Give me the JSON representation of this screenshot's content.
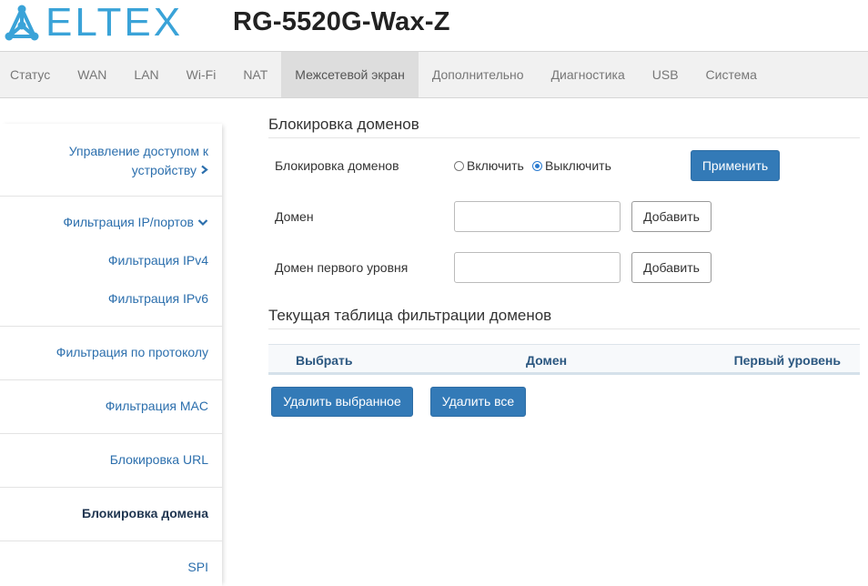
{
  "header": {
    "logo_text": "ELTEX",
    "device_title": "RG-5520G-Wax-Z"
  },
  "topnav": {
    "tabs": [
      {
        "label": "Статус"
      },
      {
        "label": "WAN"
      },
      {
        "label": "LAN"
      },
      {
        "label": "Wi-Fi"
      },
      {
        "label": "NAT"
      },
      {
        "label": "Межсетевой экран"
      },
      {
        "label": "Дополнительно"
      },
      {
        "label": "Диагностика"
      },
      {
        "label": "USB"
      },
      {
        "label": "Система"
      }
    ],
    "active": "Межсетевой экран"
  },
  "sidebar": {
    "items": [
      {
        "label_line1": "Управление доступом к",
        "label_line2": "устройству",
        "icon": "chevron-right-icon"
      },
      {
        "label": "Фильтрация IP/портов",
        "icon": "chevron-down-icon"
      },
      {
        "label": "Фильтрация IPv4"
      },
      {
        "label": "Фильтрация IPv6"
      },
      {
        "label": "Фильтрация по протоколу"
      },
      {
        "label": "Фильтрация MAC"
      },
      {
        "label": "Блокировка URL"
      },
      {
        "label": "Блокировка домена",
        "active": true
      },
      {
        "label": "SPI"
      }
    ]
  },
  "main": {
    "section_title": "Блокировка доменов",
    "blocking": {
      "label": "Блокировка доменов",
      "option_on": "Включить",
      "option_off": "Выключить",
      "selected": "Выключить",
      "apply_label": "Применить"
    },
    "domain": {
      "label": "Домен",
      "value": "",
      "add_label": "Добавить"
    },
    "tld": {
      "label": "Домен первого уровня",
      "value": "",
      "add_label": "Добавить"
    },
    "table_title": "Текущая таблица фильтрации доменов",
    "table": {
      "columns": [
        "Выбрать",
        "Домен",
        "Первый уровень"
      ],
      "rows": []
    },
    "delete_selected_label": "Удалить выбранное",
    "delete_all_label": "Удалить все"
  },
  "colors": {
    "brand": "#3aa3d8",
    "primary_button": "#337ab7",
    "link": "#2c6fad"
  }
}
